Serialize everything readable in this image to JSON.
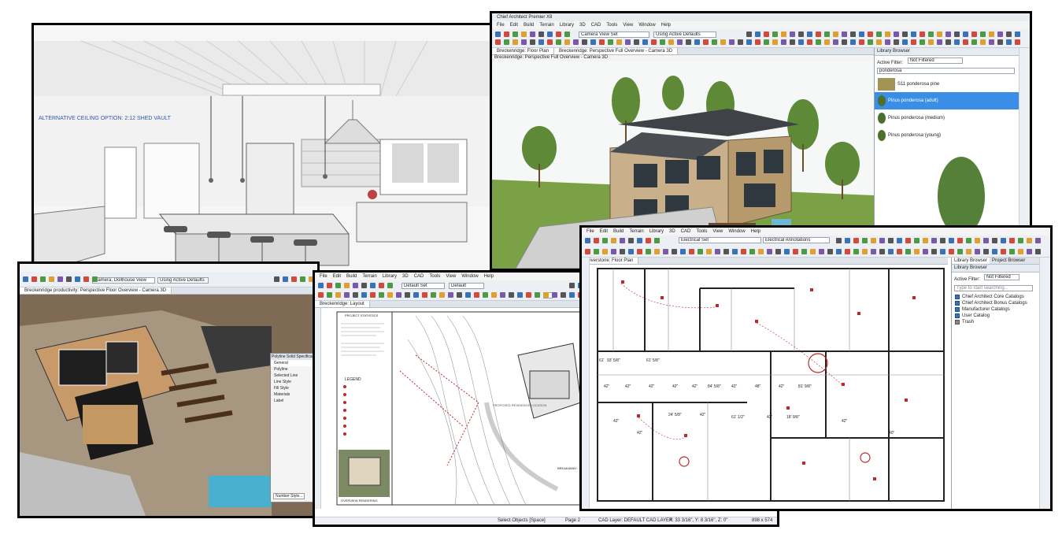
{
  "kitchen": {
    "annotation": "ALTERNATIVE CEILING OPTION: 2:12 SHED VAULT"
  },
  "exterior_window": {
    "title": "Chief Architect Premier X8",
    "menu": [
      "File",
      "Edit",
      "Build",
      "Terrain",
      "Library",
      "3D",
      "CAD",
      "Tools",
      "View",
      "Window",
      "Help"
    ],
    "camera_dropdown": "Camera View Set",
    "layer_dropdown": "Using Active Defaults",
    "tabs": [
      "Breckenridge: Floor Plan",
      "Breckenridge: Perspective Full Overview - Camera 3D"
    ],
    "subtitle": "Breckenridge: Perspective Full Overview - Camera 3D",
    "library": {
      "title": "Library Browser",
      "filter_label": "Active Filter:",
      "filter_value": "Not Filtered",
      "search": "ponderosa",
      "items": [
        "S11 ponderosa pine",
        "Pinus ponderosa (adult)",
        "Pinus ponderosa (medium)",
        "Pinus ponderosa (young)"
      ]
    }
  },
  "overview_window": {
    "camera_dropdown": "Camera, Dollhouse View",
    "layer_dropdown": "Using Active Defaults",
    "tab": "Breckenridge productivity: Perspective Floor Overview - Camera 3D",
    "dialog": {
      "title": "Polyline Solid Specification",
      "items": [
        "General",
        "Polyline",
        "Selected Line",
        "Line Style",
        "Fill Style",
        "Materials",
        "Label"
      ],
      "button": "Number Style..."
    }
  },
  "layout_window": {
    "menu": [
      "File",
      "Edit",
      "Build",
      "Terrain",
      "Library",
      "3D",
      "CAD",
      "Tools",
      "View",
      "Window",
      "Help"
    ],
    "set_dropdown": "Default Set",
    "default_dropdown": "Default",
    "page_num": "2",
    "tab": "Breckenridge: Layout",
    "sheet_heading": "PROJECT STATISTICS",
    "legend": "LEGEND",
    "site_label": "PROPOSED RESIDENCE LOCATION",
    "breakaway": "BREAKAWAY",
    "render_caption": "OVERVIEW RENDERING",
    "status": {
      "select": "Select Objects [Space]",
      "page": "Page 2",
      "layer": "CAD Layer:  DEFAULT CAD LAYER",
      "coords": "X: 33 3/16\", Y: 8 3/16\", Z: 0\"",
      "size": "898 x 574"
    }
  },
  "plan_window": {
    "menu": [
      "File",
      "Edit",
      "Build",
      "Terrain",
      "Library",
      "3D",
      "CAD",
      "Tools",
      "View",
      "Window",
      "Help"
    ],
    "set_dropdown": "Electrical Set",
    "annotation_dropdown": "Electrical Annotations",
    "tab": "Riverstone: Floor Plan",
    "dims": [
      "61'",
      "93' 5/8\"",
      "61' 5/8\"",
      "42\"",
      "42\"",
      "42\"",
      "42\"",
      "42\"",
      "84' 5/8\"",
      "42\"",
      "48\"",
      "42\"",
      "81' 9/8\"",
      "24' 5/8\"",
      "42\"",
      "61' 1/2\"",
      "42\"",
      "18' 9/8\"",
      "42\"",
      "42\"",
      "42\"",
      "40\""
    ],
    "library": {
      "tab1": "Library Browser",
      "tab2": "Project Browser",
      "title": "Library Browser",
      "filter_label": "Active Filter:",
      "filter_value": "Not Filtered",
      "search_placeholder": "Type to start searching...",
      "items": [
        "Chief Architect Core Catalogs",
        "Chief Architect Bonus Catalogs",
        "Manufacturer Catalogs",
        "User Catalog",
        "Trash"
      ]
    }
  },
  "colors": {
    "highlight": "#3a8ee6",
    "plan_red": "#c0282a",
    "grass": "#6d9a3c",
    "sky": "#f3f3f3"
  }
}
